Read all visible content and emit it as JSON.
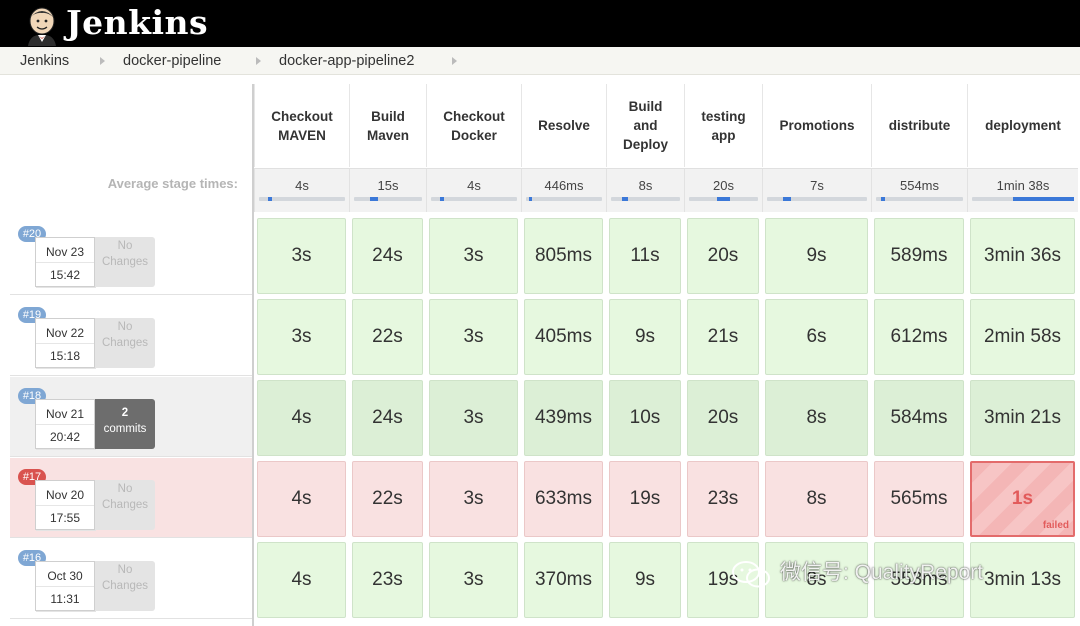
{
  "app": {
    "title": "Jenkins"
  },
  "breadcrumbs": [
    "Jenkins",
    "docker-pipeline",
    "docker-app-pipeline2"
  ],
  "average_label": "Average stage times:",
  "stages": [
    {
      "name": "Checkout\nMAVEN",
      "avg": "4s",
      "avg_fraction": 0.05
    },
    {
      "name": "Build\nMaven",
      "avg": "15s",
      "avg_fraction": 0.12
    },
    {
      "name": "Checkout\nDocker",
      "avg": "4s",
      "avg_fraction": 0.05
    },
    {
      "name": "Resolve",
      "avg": "446ms",
      "avg_fraction": 0.02
    },
    {
      "name": "Build\nand\nDeploy",
      "avg": "8s",
      "avg_fraction": 0.08
    },
    {
      "name": "testing\napp",
      "avg": "20s",
      "avg_fraction": 0.2
    },
    {
      "name": "Promotions",
      "avg": "7s",
      "avg_fraction": 0.08
    },
    {
      "name": "distribute",
      "avg": "554ms",
      "avg_fraction": 0.03
    },
    {
      "name": "deployment",
      "avg": "1min 38s",
      "avg_fraction": 0.6
    }
  ],
  "runs": [
    {
      "id": "#20",
      "date": "Nov 23",
      "time": "15:42",
      "changes": "No\nChanges",
      "status": "success",
      "durations": [
        "3s",
        "24s",
        "3s",
        "805ms",
        "11s",
        "20s",
        "9s",
        "589ms",
        "3min 36s"
      ]
    },
    {
      "id": "#19",
      "date": "Nov 22",
      "time": "15:18",
      "changes": "No\nChanges",
      "status": "success",
      "durations": [
        "3s",
        "22s",
        "3s",
        "405ms",
        "9s",
        "21s",
        "6s",
        "612ms",
        "2min 58s"
      ]
    },
    {
      "id": "#18",
      "date": "Nov 21",
      "time": "20:42",
      "changes": "2\ncommits",
      "status": "success",
      "durations": [
        "4s",
        "24s",
        "3s",
        "439ms",
        "10s",
        "20s",
        "8s",
        "584ms",
        "3min 21s"
      ]
    },
    {
      "id": "#17",
      "date": "Nov 20",
      "time": "17:55",
      "changes": "No\nChanges",
      "status": "failed",
      "durations": [
        "4s",
        "22s",
        "3s",
        "633ms",
        "19s",
        "23s",
        "8s",
        "565ms",
        "1s"
      ]
    },
    {
      "id": "#16",
      "date": "Oct 30",
      "time": "11:31",
      "changes": "No\nChanges",
      "status": "success",
      "durations": [
        "4s",
        "23s",
        "3s",
        "370ms",
        "9s",
        "19s",
        "8s",
        "553ms",
        "3min 13s"
      ]
    }
  ],
  "failed_label": "failed",
  "watermark": "微信号: QualityReport",
  "colors": {
    "header_bg": "#000000",
    "success_cell": "#e6f8df",
    "success_cell_dark": "#dcefd6",
    "failed_cell": "#f9e1e1",
    "failed_stage": "#f3b9b9",
    "badge_blue": "#7fa7d4",
    "badge_red": "#d9534f",
    "progress_blue": "#3b78d8"
  }
}
